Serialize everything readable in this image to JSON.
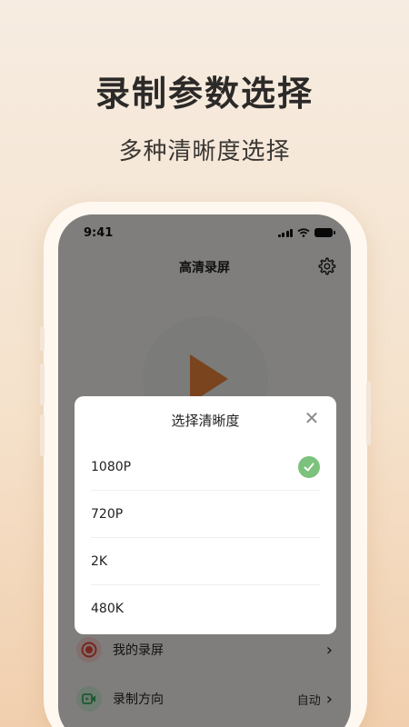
{
  "promo": {
    "headline": "录制参数选择",
    "subline": "多种清晰度选择"
  },
  "status_bar": {
    "time": "9:41"
  },
  "app": {
    "title": "高清录屏"
  },
  "menu": {
    "items": [
      {
        "label": "我的录屏",
        "value": "",
        "icon": "record-icon",
        "color": "#e24a3a"
      },
      {
        "label": "录制方向",
        "value": "自动",
        "icon": "video-icon",
        "color": "#3aa860"
      }
    ]
  },
  "modal": {
    "title": "选择清晰度",
    "options": [
      {
        "label": "1080P",
        "selected": true
      },
      {
        "label": "720P",
        "selected": false
      },
      {
        "label": "2K",
        "selected": false
      },
      {
        "label": "480K",
        "selected": false
      }
    ]
  },
  "colors": {
    "accent": "#e8833a",
    "check": "#7cc27c"
  }
}
